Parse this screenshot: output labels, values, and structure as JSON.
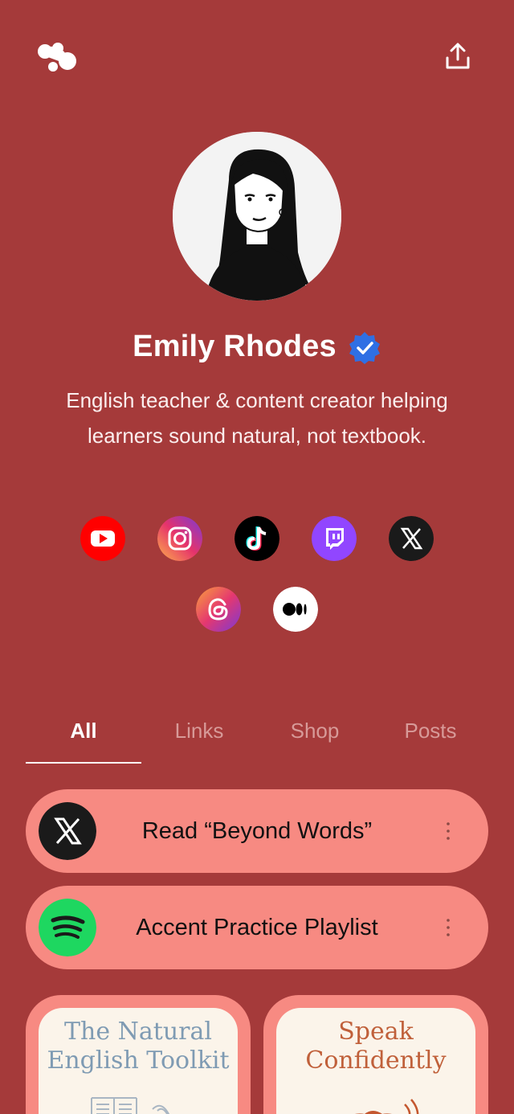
{
  "header": {
    "logo_icon": "linktree-logo-icon",
    "share_icon": "share-upload-icon"
  },
  "profile": {
    "name": "Emily Rhodes",
    "verified_icon": "verified-badge-icon",
    "bio_line1": "English teacher & content creator helping",
    "bio_line2": "learners sound natural, not textbook."
  },
  "socials": [
    "youtube-icon",
    "instagram-icon",
    "tiktok-icon",
    "twitch-icon",
    "x-icon",
    "threads-icon",
    "medium-icon"
  ],
  "tabs": [
    {
      "label": "All",
      "active": true
    },
    {
      "label": "Links",
      "active": false
    },
    {
      "label": "Shop",
      "active": false
    },
    {
      "label": "Posts",
      "active": false
    }
  ],
  "links": [
    {
      "title": "Read “Beyond Words”",
      "icon": "x-icon"
    },
    {
      "title": "Accent Practice Playlist",
      "icon": "spotify-icon"
    }
  ],
  "products": [
    {
      "title_line1": "The Natural",
      "title_line2": "English Toolkit"
    },
    {
      "title_line1": "Speak",
      "title_line2": "Confidently"
    }
  ],
  "colors": {
    "background": "#a53a3a",
    "card": "#f78a82",
    "verified": "#2f6fe4"
  }
}
